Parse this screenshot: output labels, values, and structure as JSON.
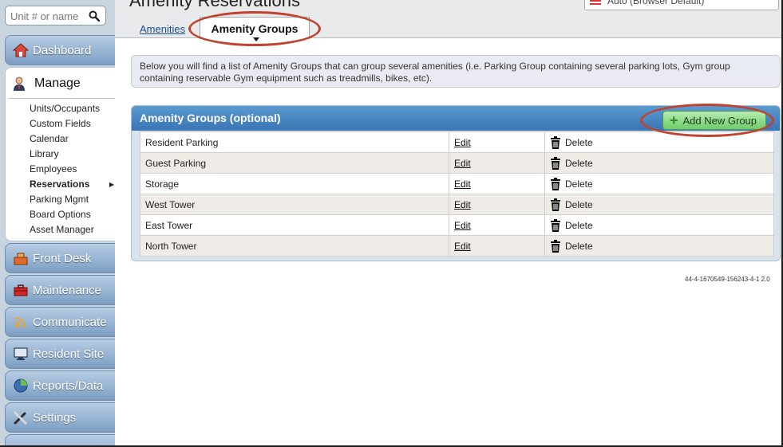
{
  "sidebar": {
    "search_placeholder": "Unit # or name",
    "nav": {
      "dashboard": "Dashboard",
      "manage": "Manage",
      "front_desk": "Front Desk",
      "maintenance": "Maintenance",
      "communicate": "Communicate",
      "resident_site": "Resident Site",
      "reports": "Reports/Data",
      "settings": "Settings"
    },
    "submenu": [
      "Units/Occupants",
      "Custom Fields",
      "Calendar",
      "Library",
      "Employees",
      "Reservations",
      "Parking Mgmt",
      "Board Options",
      "Asset Manager"
    ],
    "active_submenu": "Reservations"
  },
  "header": {
    "title": "Amenity Reservations",
    "language_select": "Auto (Browser Default)"
  },
  "tabs": {
    "amenities": "Amenities",
    "amenity_groups": "Amenity Groups"
  },
  "info_text": "Below you will find a list of Amenity Groups that can group several amenities (i.e. Parking Group containing several parking lots, Gym group containing reservable Gym equipment such as treadmills, bikes, etc).",
  "groups_panel": {
    "title": "Amenity Groups (optional)",
    "add_button": "Add New Group",
    "edit_label": "Edit",
    "delete_label": "Delete",
    "rows": [
      "Resident Parking",
      "Guest Parking",
      "Storage",
      "West Tower",
      "East Tower",
      "North Tower"
    ]
  },
  "version": "44-4-1670549-156243-4-1 2.0",
  "colors": {
    "accent_blue": "#3a74b4",
    "highlight_ring": "#c0432f",
    "add_green": "#6fcc6b"
  }
}
